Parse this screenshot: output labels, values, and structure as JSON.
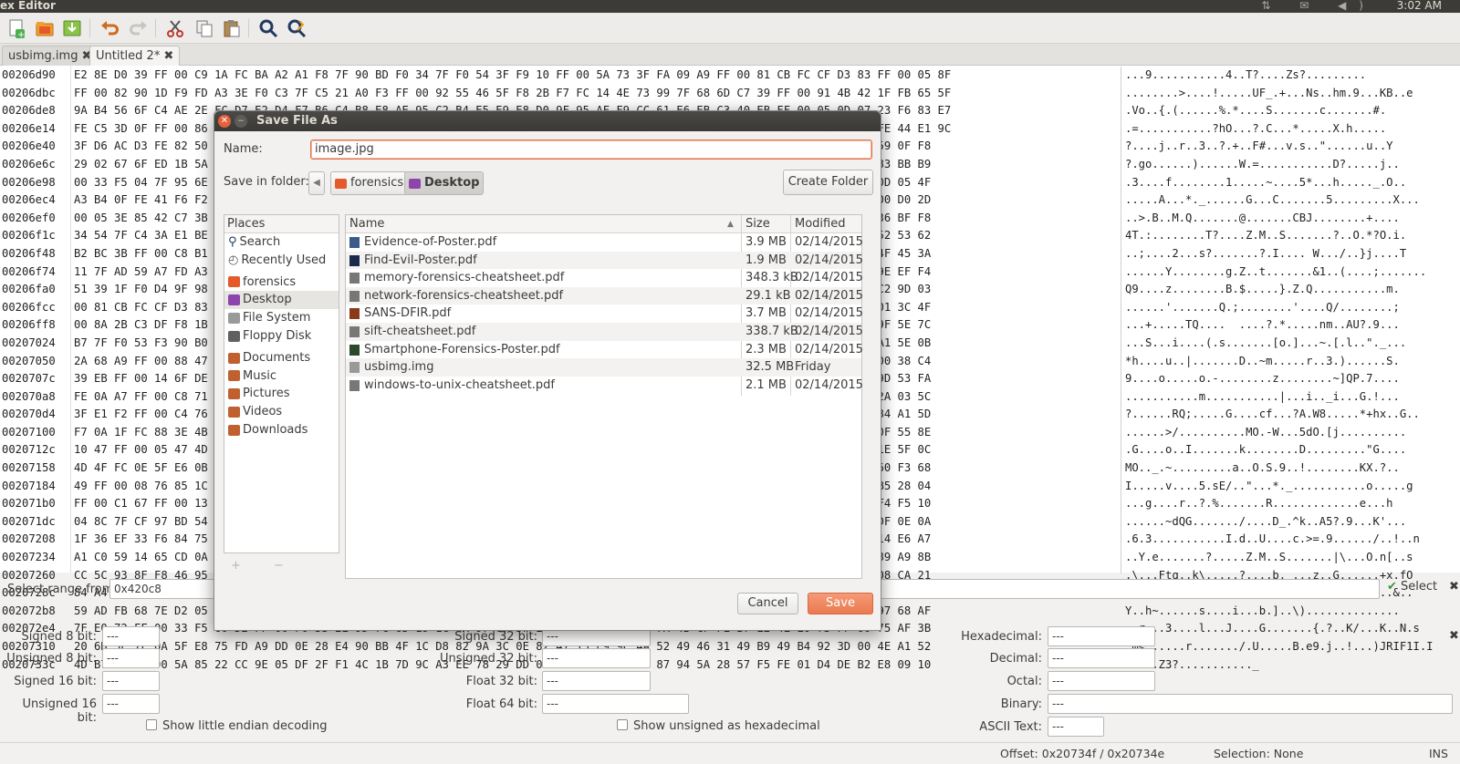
{
  "topbar": {
    "app_title": "ex Editor",
    "clock": "3:02 AM",
    "tray": "⇅ ✉ ◀)"
  },
  "toolbar": {
    "new_icon": "new-document-icon",
    "open_icon": "open-folder-icon",
    "save_icon": "save-icon",
    "undo_icon": "undo-icon",
    "redo_icon": "redo-icon",
    "cut_icon": "cut-icon",
    "copy_icon": "copy-icon",
    "paste_icon": "paste-icon",
    "find_icon": "find-icon",
    "replace_icon": "find-replace-icon"
  },
  "tabs": [
    {
      "label": "usbimg.img",
      "close": "✖"
    },
    {
      "label": "Untitled 2*",
      "close": "✖"
    }
  ],
  "hex": {
    "offsets": [
      "00206d90",
      "00206dbc",
      "00206de8",
      "00206e14",
      "00206e40",
      "00206e6c",
      "00206e98",
      "00206ec4",
      "00206ef0",
      "00206f1c",
      "00206f48",
      "00206f74",
      "00206fa0",
      "00206fcc",
      "00206ff8",
      "00207024",
      "00207050",
      "0020707c",
      "002070a8",
      "002070d4",
      "00207100",
      "0020712c",
      "00207158",
      "00207184",
      "002071b0",
      "002071dc",
      "00207208",
      "00207234",
      "00207260",
      "0020728c",
      "002072b8",
      "002072e4",
      "00207310",
      "0020733c"
    ],
    "rows": [
      "E2 8E D0 39 FF 00 C9 1A FC BA A2 A1 F8 7F 90 BD F0 34 7F F0 54 3F F9 10 FF 00 5A 73 3F FA 09 A9 FF 00 81 CB FC CF D3 83 FF 00 05 8F",
      "FF 00 82 90 1D F9 FD A3 3E F0 C3 7F C5 21 A0 F3 FF 00 92 55 46 5F F8 2B F7 FC 14 4E 73 99 7F 68 6D C7 39 FF 00 91 4B 42 1F FB 65 5F",
      "9A B4 56 6F C4 AE 2E FC D7 E2 D4 F7 B6 C4 B8 E8 AE 95 C2 B4 E5 E9 E8 D0 9F 95 AF F9 CC 61 E6 EB C3 40 EB FF 00 05 0D 07 23 F6 83 E7",
      "FE C5 3D 0F FF 00 86 E8 5D E4 2E 0F 39 BF D1 49 12 3D 4F 8E AD 73 12 E8 4F FA 12 33 28 1D 0E C1 C7 58 E0 68 AF FB 85 0F FE 44 E1 9C",
      "3F D6 AC D3 FE 82 50 1D 85 8B 3F 7F 6A 2F B0 9E 4D 37 10 96 FA 2F 3A 94 28 85 A1 C4 F2 8E 02 D0 F8 FF 00 C8 75 A2 9F 0F 59 0F F8",
      "29 02 67 6F ED 1B 5A 2E 8F E4 10 2E 9A 28 84 45 D6 FF 00 6A 50 F0 13 D9 BD AF 13 33 D0 D6 BC D7 FE 82 6A 7F E0 72 FF 1A 83 BB B9",
      "00 33 F5 04 7F 95 6E FF C5 DD 23 01 CC 58 98 6F AC E5 93 78 4B D3 25 A2 F8 7E 0B 3A A4 8F 00 5F DA 4F 00 E1 8F FF 00 8F 0D 05 4F",
      "A3 B4 0F FE 41 F6 F2 1E C3 A4 13 19 C7 3C 41 A8 84 27 5C C7 A1 7E 17 47 EE B3 E2 C2 1C BF CC FD 58 8F FE 0B 71 FF 00 FF 00 D0 2D",
      "00 05 3E 85 42 C7 3B 4E 25 A1 26 28 84 51 13 43 01 2B 53 40 3F 02 DC 70 A3 C7 F5 DA FF 00 8A 2B C3 BF FC 81 5F 94 5C 22 36 BF F8",
      "34 54 7F C4 3A E1 BE 5E 6D 3E 5D 9E CD 5E 1F 4A 2F 2F A1 1F 38 F1 17 1A 55 84 6F 4F F8 2A 37 4F F8 69 FF 00 FC 7F C2 90 52 53 62",
      "B2 BC 3B FF 00 C8 B1 CF 14 91 8A 6F 7D 99 3F 84 7F EB 67 A2 2F 8A 42 02 07 C5 A3 F0 4F F8 7D 6A B0 14 7F F0 54 3F F9 2E 4F 45 3A",
      "11 7F AD 59 A7 FD A3 F6 64 85 34 A7 86 4A D0 83 B1 01 EC D8 B4 5E 3E E3 E9 63 DE F6 52 7F F2 05 3B FE 1F 1A 7F FF 00 05 9E EF F4",
      "51 39 1F F0 D4 9F 98 A0 3F 78 C8 EA EB 51 3A 03 3C F4 AC E5 74 4C A4 C5 9C 5D C4 D1 00 C8 82 E2 AC D1 6D 89 A9 FF 4A 9C C2 9D 03",
      "00 81 CB FC CF D3 83 FF 00 9B 81 6F 2E A5 6C 57 A7 C4 82 0E 9A 6C 06 E0 FF 00 F1 8A A4 0C 00 FE 0A 84 B9 C7 ED 3B 8C F5 01 3C 4F",
      "00 8A 2B C3 DF F8 1B 12 0E 55 2E 7D 00 8B FF 00 F0 EA 1F 3F 89 F1 1F 3E 60 F8 2A 7C 06 55 3F F0 39 7F 99 FA B1 84 27 3B 9F 5E 7C",
      "B7 7F F0 53 F3 90 B0 E8 3B 1B 3E 3B 7B 47 5F 4B D5 EB D6 D2 A8 02 D3 E8 8D 31 FF 00 22 5F 87 BF F9 06 BF 6E 6C DC 8B 8B A1 5E 0B",
      "2A 68 A9 FF 00 88 47 5E 59 0B 3A 09 6C 54 9B 14 33 3B 1E E0 18 DD 2A 3A B4 FF 00 F0 53 17 CE EF DA 57 F3 63 58 A2 C3 3A 00 38 C4",
      "39 EB FF 00 14 6F DE 9A D0 24 E0 81 68 F0 37 CB 58 A1 DF 5D 51 50 FC 37 E1 D7 BE 02 87 59 7F 37 26 78 4C 73 3C 94 84 8E 9D 53 FA",
      "FE 0A A7 FF 00 C8 71 4B 4B 88 54 D8 90 8A 46 A7 E3 FD 7C AE 1C D2 5B 47 FC 21 FA 07 FF 00 20 FB 53 C3 5E E1 80 DA 7F 86 2A 03 5C",
      "3F E1 F2 FF 00 C4 76 F6 2B 69 06 E0 1C 55 4E 18 07 97 8F E2 16 47 68 78 7F 90 47 E1 C0 D1 53 07 77 B2 CA 44 9B 3A 27 64 84 A1 5D",
      "F7 0A 1F FC 88 3E 4B 92 E1 9F E2 D6 EE B5 6E 2D 49 92 65 7A F0 86 F8 7F 9F FC 91 A8 5B FE F4 6F 6E 85 E5 C8 0F CD 7C 93 0F 55 8E",
      "10 47 FF 00 05 47 4D 9E 3D 6F 09 C8 C6 9D 5A 01 5F 1A 9D 4D 6B B7 91 24 EB FF 00 22 47 FA 9A FF 00 D0 7C 3A 42 F1 AB 9D 1E 5F 0C",
      "4D 4F FC 0E 5F E6 0B 84 DA 75 5D 35 D7 1E 07 B4 9E B1 E6 F4 1B 68 82 D1 7F C1 4B 58 EE 3F B4 9E 1A 92 A2 FA 05 7D 16 C3 60 F3 68",
      "49 FF 00 08 76 85 1C F0 A8 5F 94 42 2E 9A 10 05 D6 81 CB 1C 73 A1 3E 30 02 9D AC D4 FF 00 C0 E5 FE 67 EA C3 23 DD AF 11 B5 28 04",
      "FF 00 C1 67 FF 00 13 33 95 C4 53 B3 46 44 EB A2 0A 41 AC 87 2C B6 D3 67 E2 7D 1D D1 9B C2 B1 65 1F F0 88 68 23 06 F0 B2 F4 F5 10",
      "04 8C 7F CF 97 BD 54 FF 00 E0 53 FE 07 E6 5A CE 17 ED 2B 9C C1 B2 DE 01 8F 67 C6 D2 A2 C2 02 F4 67 7F 99 FA 4B 27 FC 15 DF 0E 0A",
      "1F 36 EF 33 F6 84 75 3F 1A 9A 2E BA 8E F1 5D 3E 1E F2 A5 6F B7 E4 5E 3D 5E 26 2A 41 F4 1A 52 8A DA 2F FF 00 21 D7 E7 6D 14 E6 A7",
      "A1 C0 59 14 65 CD 0A 96 F3 FC AC 78 8C 56 42 7C 21 88 E5 59 D4 C9 DF 72 5D 44 DE 45 0E 87 C1 4F BF 6E 5B C5 DB 73 F1 C3 89 A9 8B",
      "CC 5C 93 8F F8 46 95 45 7B C8 88 C9 A2 D4 E2 85 B9 DA 9A 54 3C 96 7C 4B 45 D1 92 5E 6E AE 0B AB E2 2B 78 F0 66 4F 1D 63 08 CA 21",
      "84 A4 BF EE 1C 3F 4E 1A 25 4D E0 8E 2F 72 39 E4 95 95 AE FF 00 7D C8 CA 0B 16 C7 A9 C5 0A 70 DA DF F1 24 D3 86 47 E1 6F 27 42 F8",
      "59 AD FB 68 7E D2 05 20 B7 A1 C4 B0 CE 7F 4E 8A D3 D7 10 D0 0E 2B 3B 2A 75 3A 3C 93 81 2C FF 00 90 BF D6 9C CF FE 82 6A 97 68 AF",
      "7F E0 72 FF 00 33 F5 60 D2 FF 00 F0 53 2E 9D 7C 65 19 1C 6A 97 67 5F E3 D3 CF 8A 3F B7 7A 4B CF FE B7 E2 4E E0 73 FF 00 75 AF 3B",
      "20 6D 3C 7F 0A 5F E8 75 FD A9 DD 0E 28 E4 90 BB 4F 1C D8 82 9A 3C 0E 82 47 13 E9 9C 4A 52 49 46 31 49 B9 49 B4 92 3D 00 4E A1 52",
      "4D B7 60 FF 00 5A 85 22 CC 9E 05 DF 2F F1 4C 1B 7D 9C A3 EE 78 29 DD 0E 22 B1 6C 48 6E 87 94 5A 28 57 F5 FE 01 D4 DE B2 E8 09 10"
    ],
    "ascii": [
      "...9...........4..T?....Zs?.........",
      "........>....!.....UF_.+...Ns..hm.9...KB..e",
      ".Vo..{.(......%.*....S.......c.......#.",
      ".=...........?hO...?.C...*.....X.h.....",
      "?....j..r..3..?.+..F#...v.s..\"......u..Y",
      "?.go......)......W.=...........D?.....j..",
      ".3....f........1.....~....5*...h....._.O..",
      ".....A...*._......G...C.......5.........X...",
      "..>.B..M.Q.......@.......CBJ........+....",
      "4T.:........T?....Z.M..S.......?..O.*?O.i.",
      "..;....2...s?.......?.I.... W.../..}j....T",
      "......Y........g.Z..t.......&1..(....;.......",
      "Q9....z........B.$.....}.Z.Q...........m.",
      "......'.......Q.;........'....Q/........;",
      "...+.....TQ....  ....?.*.....nm..AU?.9...",
      "...S...i....(.s.......[o.]...~.[.l..\"._...",
      "*h....u..|.......D..~m.....r..3.)......S.",
      "9....o.....o.-........z........~]QP.7....",
      "...........m...........|...i.._i...G.!...",
      "?......RQ;.....G....cf...?A.W8.....*+hx..G..",
      "......>/..........MO.-W...5dO.[j..........",
      ".G....o..I.......k........D.........\"G....",
      "MO.._.~.........a..O.S.9..!........KX.?..",
      "I.....v....5.sE/..\"...*._...........o.....g",
      "...g....r..?.%.......R.............e...h",
      "......~dQG......./....D_.^k..A5?.9...K'...",
      ".6.3...........I.d..U....c.>=.9....../..!..n",
      "..Y.e.......?.....Z.M..S.......|\\...O.n[..s",
      ".\\...Ftq..k\\.....?....b._...z..G......+x.fO",
      "......?._.Ni..A5?.9........S...._..7p...&..",
      "Y..h~......s....i...b.]..\\)..............",
      "..r...3....l...J....G.......{.?..K/...K..N.s",
      " m<......r......./.U.....B.e9.j..!...)JRIF1I.I",
      "M.'..Z3?..........._"
    ]
  },
  "range": {
    "label": "Select range from:",
    "value": "0x420c8",
    "select_label": "Select",
    "close": "✖"
  },
  "inspector": {
    "signed8_label": "Signed 8 bit:",
    "signed8_value": "---",
    "unsigned8_label": "Unsigned 8 bit:",
    "unsigned8_value": "---",
    "signed16_label": "Signed 16 bit:",
    "signed16_value": "---",
    "unsigned16_label": "Unsigned 16 bit:",
    "unsigned16_value": "---",
    "signed32_label": "Signed 32 bit:",
    "signed32_value": "---",
    "unsigned32_label": "Unsigned 32 bit:",
    "unsigned32_value": "---",
    "float32_label": "Float 32 bit:",
    "float32_value": "---",
    "float64_label": "Float 64 bit:",
    "float64_value": "---",
    "hex_label": "Hexadecimal:",
    "hex_value": "---",
    "dec_label": "Decimal:",
    "dec_value": "---",
    "oct_label": "Octal:",
    "oct_value": "---",
    "bin_label": "Binary:",
    "bin_value": "---",
    "ascii_label": "ASCII Text:",
    "ascii_value": "---",
    "little_endian_label": "Show little endian decoding",
    "unsigned_hex_label": "Show unsigned as hexadecimal",
    "close": "✖"
  },
  "status": {
    "offset": "Offset: 0x20734f / 0x20734e",
    "selection": "Selection: None",
    "mode": "INS"
  },
  "dialog": {
    "title": "Save File As",
    "close": "✕",
    "min": "−",
    "name_label": "Name:",
    "name_value": "image.jpg",
    "folder_label": "Save in folder:",
    "crumbs": [
      "forensics",
      "Desktop"
    ],
    "create_folder": "Create Folder",
    "places_header": "Places",
    "places": [
      "Search",
      "Recently Used",
      "forensics",
      "Desktop",
      "File System",
      "Floppy Disk",
      "Documents",
      "Music",
      "Pictures",
      "Videos",
      "Downloads"
    ],
    "places_ctrl": "+ −",
    "col_name": "Name",
    "col_size": "Size",
    "col_modified": "Modified",
    "files": [
      {
        "name": "Evidence-of-Poster.pdf",
        "size": "3.9 MB",
        "modified": "02/14/2015"
      },
      {
        "name": "Find-Evil-Poster.pdf",
        "size": "1.9 MB",
        "modified": "02/14/2015"
      },
      {
        "name": "memory-forensics-cheatsheet.pdf",
        "size": "348.3 kB",
        "modified": "02/14/2015"
      },
      {
        "name": "network-forensics-cheatsheet.pdf",
        "size": "29.1 kB",
        "modified": "02/14/2015"
      },
      {
        "name": "SANS-DFIR.pdf",
        "size": "3.7 MB",
        "modified": "02/14/2015"
      },
      {
        "name": "sift-cheatsheet.pdf",
        "size": "338.7 kB",
        "modified": "02/14/2015"
      },
      {
        "name": "Smartphone-Forensics-Poster.pdf",
        "size": "2.3 MB",
        "modified": "02/14/2015"
      },
      {
        "name": "usbimg.img",
        "size": "32.5 MB",
        "modified": "Friday"
      },
      {
        "name": "windows-to-unix-cheatsheet.pdf",
        "size": "2.1 MB",
        "modified": "02/14/2015"
      }
    ],
    "cancel": "Cancel",
    "save": "Save"
  },
  "colors": {
    "offset": "#c0392b",
    "hex_alt": "#2a3db8",
    "accent": "#ea7a50",
    "titlebar": "#3c3b37"
  }
}
